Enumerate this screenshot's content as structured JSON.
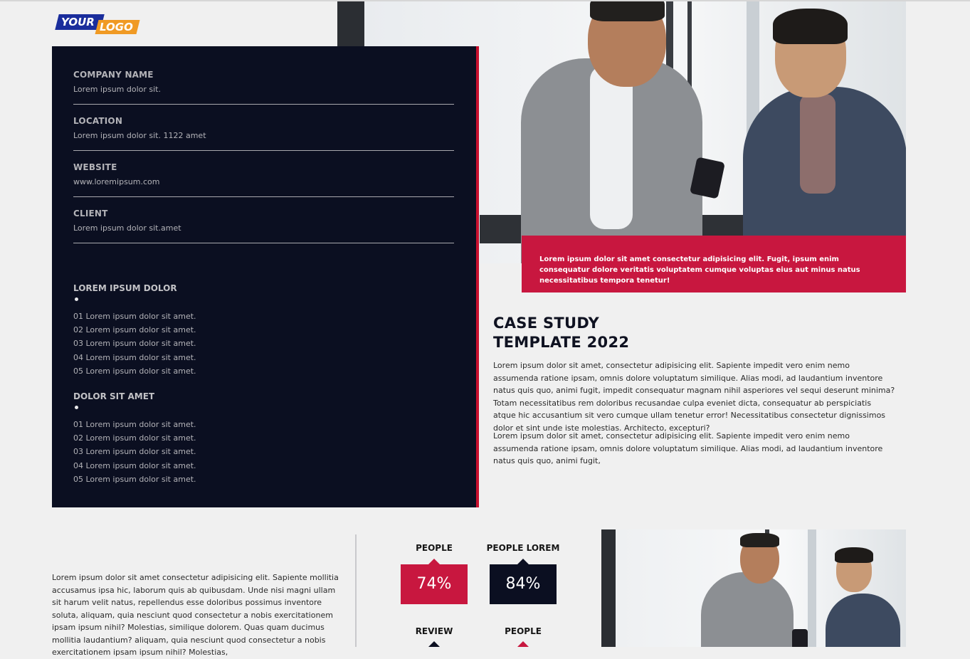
{
  "logo": {
    "word1": "YOUR",
    "word2": "LOGO"
  },
  "info": {
    "fields": [
      {
        "label": "COMPANY NAME",
        "value": "Lorem ipsum dolor sit."
      },
      {
        "label": "LOCATION",
        "value": "Lorem ipsum dolor sit. 1122 amet"
      },
      {
        "label": "WEBSITE",
        "value": "www.loremipsum.com"
      },
      {
        "label": "CLIENT",
        "value": "Lorem ipsum dolor sit.amet"
      }
    ],
    "section1": {
      "title": "LOREM IPSUM DOLOR",
      "items": [
        "01  Lorem ipsum dolor sit amet.",
        "02  Lorem ipsum dolor sit amet.",
        "03  Lorem ipsum dolor sit amet.",
        "04  Lorem ipsum dolor sit amet.",
        "05  Lorem ipsum dolor sit amet."
      ]
    },
    "section2": {
      "title": "DOLOR SIT AMET",
      "items": [
        "01  Lorem ipsum dolor sit amet.",
        "02  Lorem ipsum dolor sit amet.",
        "03  Lorem ipsum dolor sit amet.",
        "04  Lorem ipsum dolor sit amet.",
        "05  Lorem ipsum dolor sit amet."
      ]
    }
  },
  "caption": "Lorem ipsum dolor sit amet consectetur adipisicing elit. Fugit, ipsum enim consequatur dolore veritatis voluptatem cumque voluptas eius aut minus natus necessitatibus tempora tenetur!",
  "case_study": {
    "title_line1": "CASE STUDY",
    "title_line2": "TEMPLATE 2022",
    "para1": "Lorem ipsum dolor sit amet, consectetur adipisicing elit. Sapiente impedit vero enim nemo assumenda ratione ipsam, omnis dolore voluptatum similique. Alias modi, ad laudantium inventore natus quis quo, animi fugit, impedit consequatur magnam nihil asperiores vel sequi deserunt minima? Totam necessitatibus rem doloribus recusandae culpa eveniet dicta, consequatur ab perspiciatis atque hic accusantium sit vero cumque ullam tenetur error! Necessitatibus consectetur dignissimos dolor et sint unde iste molestias. Architecto, excepturi?",
    "para2": "Lorem ipsum dolor sit amet, consectetur adipisicing elit. Sapiente impedit vero enim nemo assumenda ratione ipsam, omnis dolore voluptatum similique. Alias modi, ad laudantium inventore natus quis quo, animi fugit,"
  },
  "bottom_text": "Lorem ipsum dolor sit amet consectetur adipisicing elit. Sapiente mollitia accusamus ipsa hic, laborum quis ab quibusdam. Unde nisi magni ullam sit harum velit natus, repellendus esse doloribus possimus inventore soluta, aliquam, quia nesciunt quod consectetur a nobis exercitationem ipsam ipsum nihil? Molestias, similique dolorem. Quas quam ducimus mollitia laudantium? aliquam, quia nesciunt quod consectetur a nobis exercitationem ipsam ipsum nihil? Molestias,",
  "stats": [
    {
      "label": "PEOPLE",
      "value": "74%",
      "color": "#c8173f"
    },
    {
      "label": "PEOPLE LOREM",
      "value": "84%",
      "color": "#0b0f21"
    },
    {
      "label": "REVIEW",
      "color": "#0b0f21"
    },
    {
      "label": "PEOPLE",
      "color": "#c8173f"
    }
  ],
  "colors": {
    "navy": "#0b0f21",
    "crimson": "#c8173f",
    "background": "#f0f0f0"
  }
}
